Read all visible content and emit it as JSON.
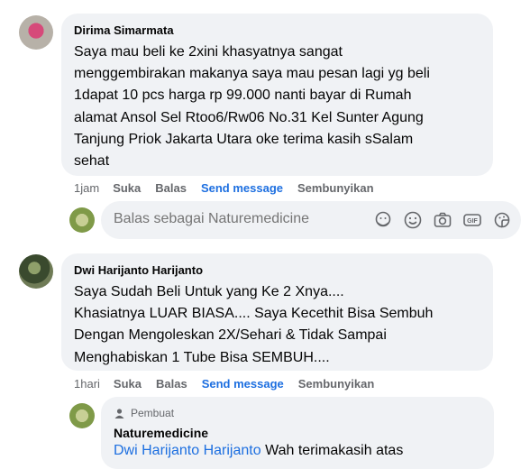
{
  "comments": [
    {
      "author": "Dirima Simarmata",
      "lines": [
        "Saya mau beli ke 2xini khasyatnya sangat",
        "menggembirakan makanya saya mau pesan lagi yg beli",
        "1dapat 10 pcs harga rp 99.000 nanti bayar di Rumah",
        "alamat Ansol Sel Rtoo6/Rw06 No.31 Kel Sunter Agung",
        "Tanjung Priok Jakarta Utara oke terima kasih sSalam",
        "sehat"
      ],
      "time": "1jam",
      "like": "Suka",
      "reply": "Balas",
      "send": "Send message",
      "hide": "Sembunyikan"
    },
    {
      "author": "Dwi Harijanto Harijanto",
      "lines": [
        "Saya Sudah Beli Untuk yang Ke 2 Xnya....",
        "Khasiatnya LUAR BIASA.... Saya Kecethit Bisa Sembuh",
        "Dengan Mengoleskan 2X/Sehari & Tidak Sampai",
        "Menghabiskan 1 Tube Bisa SEMBUH...."
      ],
      "time": "1hari",
      "like": "Suka",
      "reply": "Balas",
      "send": "Send message",
      "hide": "Sembunyikan"
    }
  ],
  "reply_box": {
    "placeholder": "Balas sebagai Naturemedicine",
    "icons": [
      "avatar-sticker-icon",
      "emoji-icon",
      "camera-icon",
      "gif-icon",
      "sticker-icon"
    ]
  },
  "page_reply": {
    "badge": "Pembuat",
    "author": "Naturemedicine",
    "mention": "Dwi Harijanto Harijanto",
    "text": " Wah terimakasih atas"
  },
  "colors": {
    "bubble": "#f0f2f5",
    "secondary_text": "#65676b",
    "link": "#1d6fe0"
  }
}
